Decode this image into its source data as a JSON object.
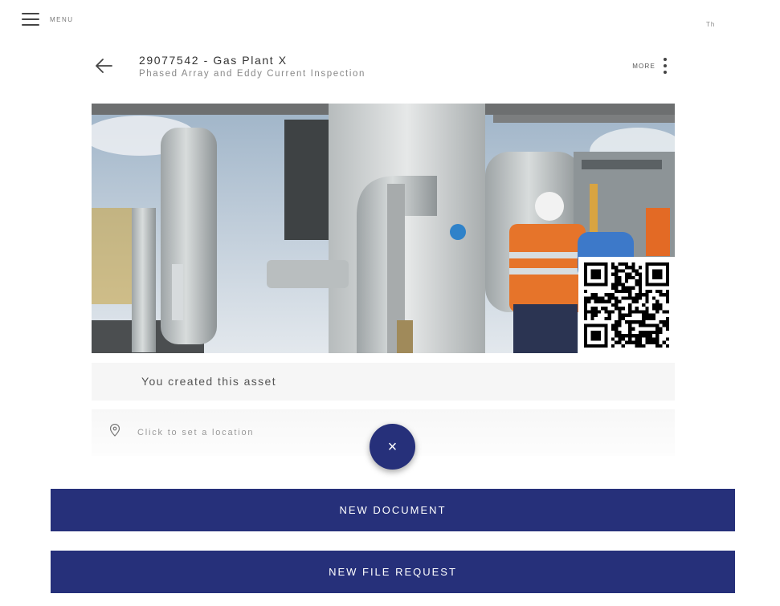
{
  "nav": {
    "menu_label": "MENU",
    "top_right_text": "Th"
  },
  "header": {
    "title": "29077542 - Gas Plant X",
    "subtitle": "Phased Array and Eddy Current Inspection",
    "more_label": "MORE"
  },
  "asset": {
    "created_text": "You created this asset"
  },
  "location": {
    "placeholder_text": "Click to set a location"
  },
  "fab": {
    "symbol": "×"
  },
  "actions": {
    "new_document": "NEW DOCUMENT",
    "new_file_request": "NEW FILE REQUEST"
  },
  "icons": {
    "menu": "hamburger-icon",
    "back": "arrow-left-icon",
    "more": "more-vertical-icon",
    "location": "map-pin-icon",
    "close": "close-icon"
  },
  "colors": {
    "primary": "#26307a",
    "panel": "#f6f6f6"
  }
}
